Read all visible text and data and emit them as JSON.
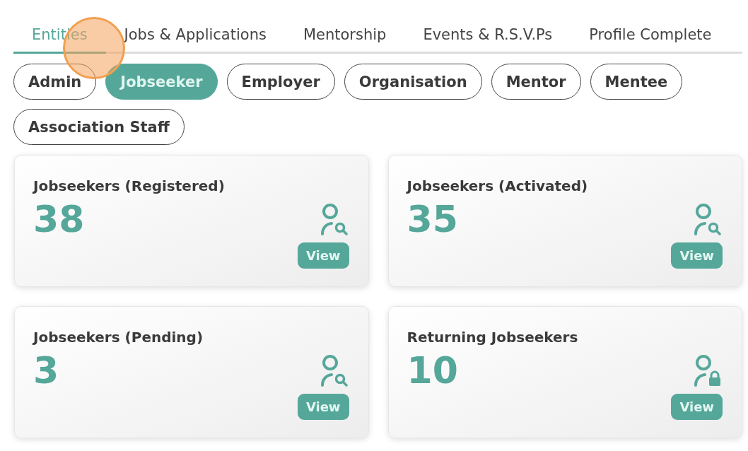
{
  "tabs": [
    {
      "label": "Entities",
      "selected": true
    },
    {
      "label": "Jobs & Applications",
      "selected": false
    },
    {
      "label": "Mentorship",
      "selected": false
    },
    {
      "label": "Events & R.S.V.Ps",
      "selected": false
    },
    {
      "label": "Profile Complete",
      "selected": false
    }
  ],
  "filters": [
    {
      "label": "Admin",
      "selected": false
    },
    {
      "label": "Jobseeker",
      "selected": true
    },
    {
      "label": "Employer",
      "selected": false
    },
    {
      "label": "Organisation",
      "selected": false
    },
    {
      "label": "Mentor",
      "selected": false
    },
    {
      "label": "Mentee",
      "selected": false
    },
    {
      "label": "Association Staff",
      "selected": false
    }
  ],
  "cards": [
    {
      "title": "Jobseekers (Registered)",
      "count": "38",
      "kind": "search",
      "button": "View"
    },
    {
      "title": "Jobseekers (Activated)",
      "count": "35",
      "kind": "search",
      "button": "View"
    },
    {
      "title": "Jobseekers (Pending)",
      "count": "3",
      "kind": "search",
      "button": "View"
    },
    {
      "title": "Returning Jobseekers",
      "count": "10",
      "kind": "lock",
      "button": "View"
    }
  ]
}
